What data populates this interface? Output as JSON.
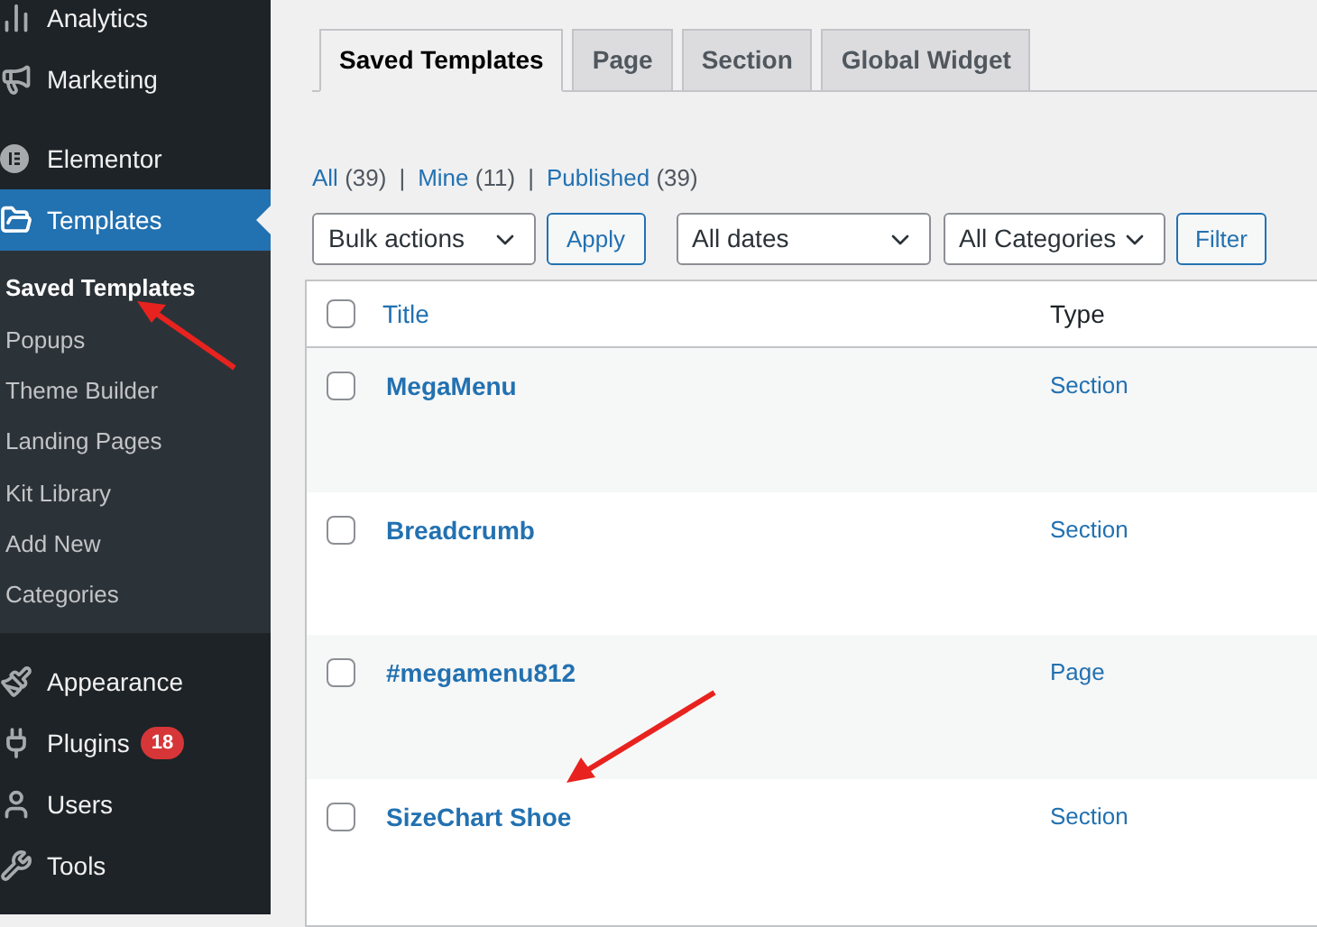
{
  "sidebar": {
    "items": [
      {
        "label": "Analytics",
        "selected": false
      },
      {
        "label": "Marketing",
        "selected": false
      },
      {
        "label": "Elementor",
        "selected": false
      },
      {
        "label": "Templates",
        "selected": true,
        "children": [
          {
            "label": "Saved Templates",
            "selected": true
          },
          {
            "label": "Popups",
            "selected": false
          },
          {
            "label": "Theme Builder",
            "selected": false
          },
          {
            "label": "Landing Pages",
            "selected": false
          },
          {
            "label": "Kit Library",
            "selected": false
          },
          {
            "label": "Add New",
            "selected": false
          },
          {
            "label": "Categories",
            "selected": false
          }
        ]
      },
      {
        "label": "Appearance",
        "selected": false
      },
      {
        "label": "Plugins",
        "selected": false,
        "badge": "18"
      },
      {
        "label": "Users",
        "selected": false
      },
      {
        "label": "Tools",
        "selected": false
      }
    ]
  },
  "tabs": [
    {
      "label": "Saved Templates",
      "selected": true
    },
    {
      "label": "Page",
      "selected": false
    },
    {
      "label": "Section",
      "selected": false
    },
    {
      "label": "Global Widget",
      "selected": false
    }
  ],
  "filters": [
    {
      "label": "All",
      "count": "(39)"
    },
    {
      "separator": "|",
      "label": "Mine",
      "count": "(11)"
    },
    {
      "separator": "|",
      "label": "Published",
      "count": "(39)"
    }
  ],
  "toolbar": {
    "bulk_actions": "Bulk actions",
    "apply": "Apply",
    "dates": "All dates",
    "categories": "All Categories",
    "filter": "Filter"
  },
  "table": {
    "columns": [
      "Title",
      "Type"
    ],
    "select_all_checked": false,
    "rows": [
      {
        "title": "MegaMenu",
        "type": "Section",
        "checked": false
      },
      {
        "title": "Breadcrumb",
        "type": "Section",
        "checked": false
      },
      {
        "title": "#megamenu812",
        "type": "Page",
        "checked": false
      },
      {
        "title": "SizeChart Shoe",
        "type": "Section",
        "checked": false
      }
    ]
  }
}
